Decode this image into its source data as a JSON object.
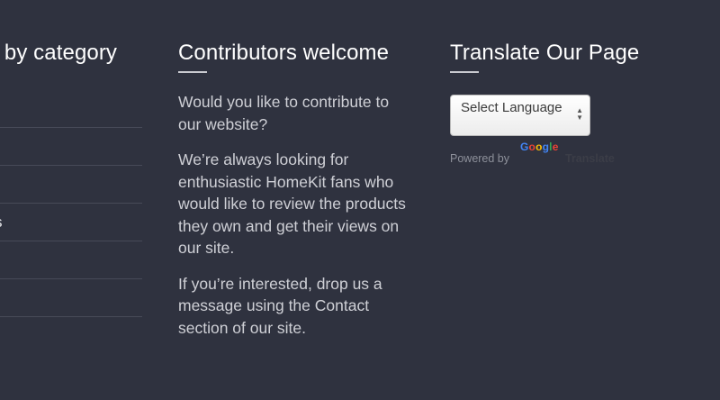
{
  "categories": {
    "heading": "s by category",
    "items": [
      {
        "label": ""
      },
      {
        "label": ""
      },
      {
        "label": ""
      },
      {
        "label": "s"
      },
      {
        "label": ""
      },
      {
        "label": ""
      }
    ]
  },
  "contributors": {
    "heading": "Contributors welcome",
    "paragraphs": [
      "Would you like to contribute to our website?",
      "We’re always looking for enthusiastic HomeKit fans who would like to review the products they own and get their views on our site.",
      "If you’re interested, drop us a message using the Contact section of our site."
    ]
  },
  "translate": {
    "heading": "Translate Our Page",
    "select_value": "Select Language",
    "powered_by": "Powered by",
    "logo_text": "Google",
    "translate_link": "Translate"
  },
  "colors": {
    "background": "#2f323f",
    "heading": "#ffffff",
    "body_text": "#cfd0d6",
    "divider": "#474a58"
  }
}
